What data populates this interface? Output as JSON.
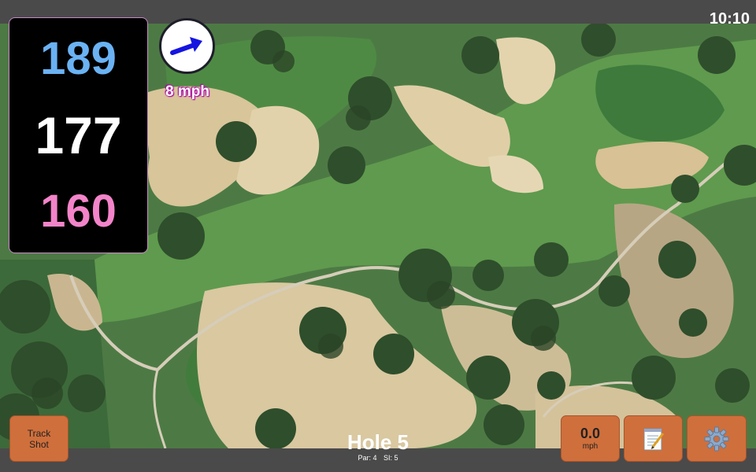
{
  "status": {
    "clock": "10:10"
  },
  "distances": {
    "back": "189",
    "middle": "177",
    "front": "160"
  },
  "wind": {
    "speed": "8 mph",
    "icon": "wind-arrow-icon"
  },
  "hole": {
    "title": "Hole 5",
    "par": "Par: 4",
    "stroke_index": "SI: 5"
  },
  "buttons": {
    "track_shot": "Track\nShot",
    "speed_value": "0.0",
    "speed_unit": "mph",
    "notes_icon": "notepad-icon",
    "settings_icon": "gear-icon"
  },
  "colors": {
    "back": "#6ab2f3",
    "middle": "#ffffff",
    "front": "#f384c9",
    "button": "#cf6f3c",
    "bar": "#4a4a4a"
  }
}
